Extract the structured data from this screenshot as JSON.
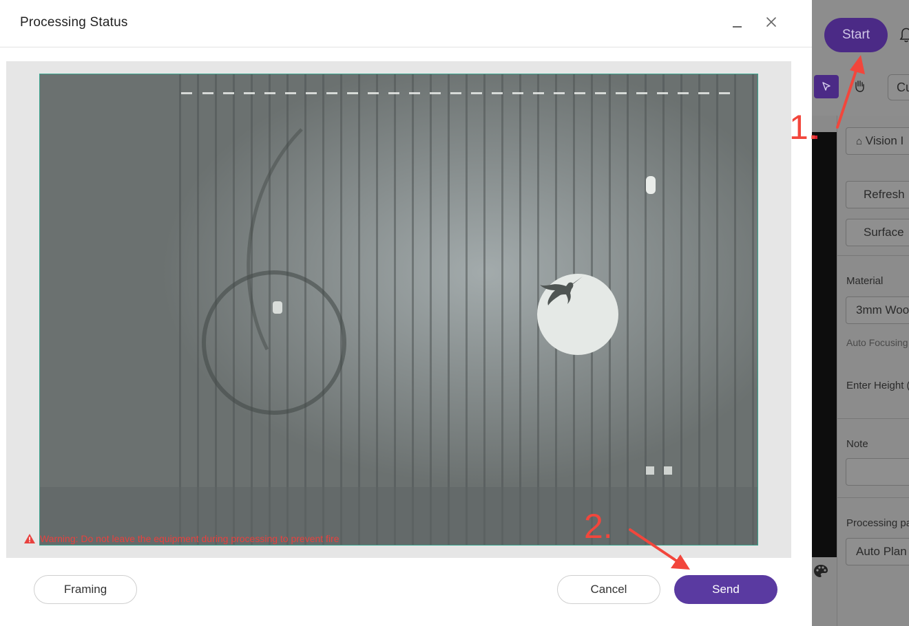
{
  "dialog": {
    "title": "Processing Status",
    "warning": "Warning: Do not leave the equipment during processing to prevent fire",
    "buttons": {
      "framing": "Framing",
      "cancel": "Cancel",
      "send": "Send"
    }
  },
  "app": {
    "start_label": "Start",
    "tool_select_label": "Cu",
    "panel": {
      "vision_label": "Vision I",
      "refresh_label": "Refresh",
      "surface_label": "Surface",
      "material_label": "Material",
      "material_value": "3mm Woo",
      "auto_focusing_label": "Auto Focusing",
      "enter_height_label": "Enter Height (",
      "note_label": "Note",
      "processing_path_label": "Processing pa",
      "processing_path_value": "Auto Plan"
    }
  },
  "annotations": {
    "step1": "1.",
    "step2": "2."
  },
  "colors": {
    "primary": "#5a3aa1",
    "warning": "#e8413e",
    "frame": "#3aa58f",
    "annotation": "#f2463c"
  }
}
